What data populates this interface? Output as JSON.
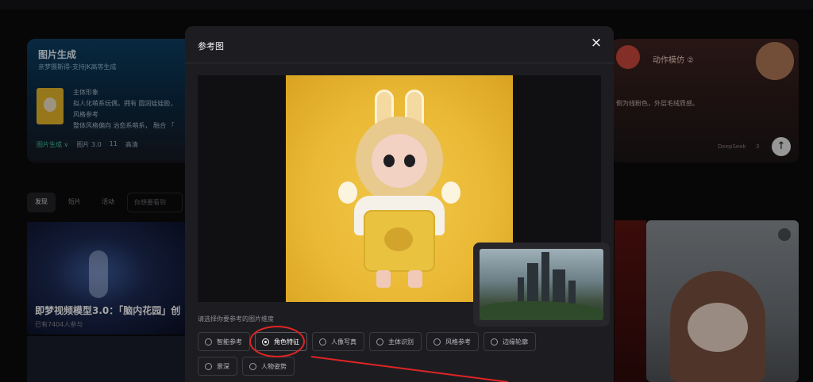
{
  "background": {
    "left_card": {
      "title": "图片生成",
      "subtitle": "亲梦摄斯得-支持JK高等生成",
      "line1": "主体形象",
      "line2": "拟人化萌系玩偶，拥有 圆润娃娃脸，",
      "line3": "风格参考",
      "line4": "整体风格偏向 治愈系萌系， 融合 「",
      "chips": [
        "图片生成 ∨",
        "图片 3.0",
        "11",
        "高清"
      ]
    },
    "right_card": {
      "title": "动作模仿 ②",
      "desc": "侧为线粉色，外层毛绒质感。",
      "brand": "DeepSeek",
      "likes": "3",
      "up_icon": "↑"
    },
    "tabs": [
      "发现",
      "短片",
      "活动"
    ],
    "search_placeholder": "你想要看到",
    "video_title": "即梦视频模型3.0：「脑内花园」创",
    "video_sub": "已有7404人参与"
  },
  "modal": {
    "title": "参考图",
    "close_icon": "×",
    "instruction": "请选择你要参考的图片维度",
    "options": [
      {
        "label": "智能参考",
        "selected": false
      },
      {
        "label": "角色特征",
        "selected": true
      },
      {
        "label": "人像写真",
        "selected": false
      },
      {
        "label": "主体识别",
        "selected": false
      },
      {
        "label": "风格参考",
        "selected": false
      },
      {
        "label": "边缘轮廓",
        "selected": false
      },
      {
        "label": "景深",
        "selected": false
      },
      {
        "label": "人物姿势",
        "selected": false
      }
    ]
  },
  "colors": {
    "modal_bg": "#1d1d21",
    "highlight": "#e02424",
    "preview_bg": "#eab935"
  }
}
